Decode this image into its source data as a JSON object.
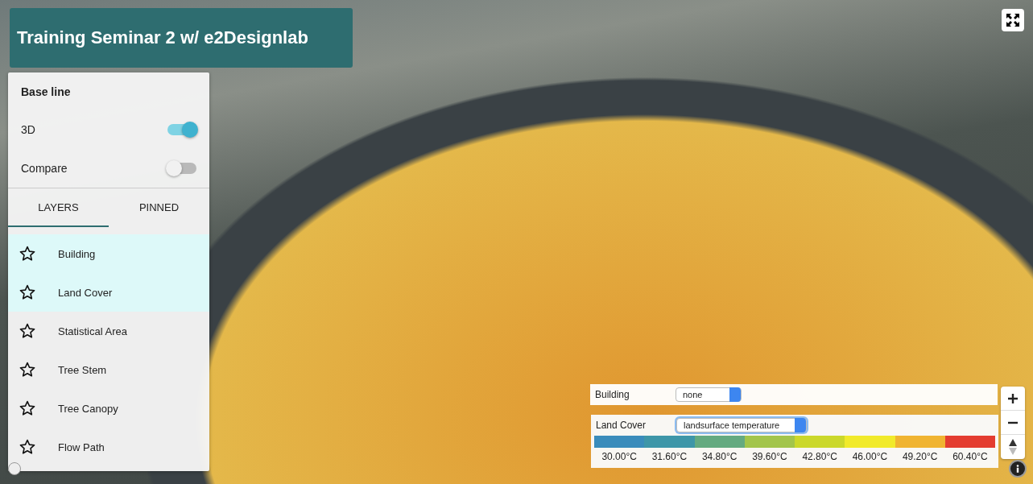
{
  "title": "Training Seminar 2 w/ e2Designlab",
  "panel": {
    "heading": "Base line",
    "toggles": [
      {
        "label": "3D",
        "on": true
      },
      {
        "label": "Compare",
        "on": false
      }
    ],
    "tabs": [
      {
        "label": "LAYERS",
        "selected": true
      },
      {
        "label": "PINNED",
        "selected": false
      }
    ],
    "layers": [
      {
        "label": "Building",
        "selected": true
      },
      {
        "label": "Land Cover",
        "selected": true
      },
      {
        "label": "Statistical Area",
        "selected": false
      },
      {
        "label": "Tree Stem",
        "selected": false
      },
      {
        "label": "Tree Canopy",
        "selected": false
      },
      {
        "label": "Flow Path",
        "selected": false
      }
    ]
  },
  "building_control": {
    "label": "Building",
    "value": "none"
  },
  "land_cover_legend": {
    "label": "Land Cover",
    "value": "landsurface temperature",
    "stops": [
      {
        "label": "30.00°C",
        "color": "#3a8cbb"
      },
      {
        "label": "31.60°C",
        "color": "#3e96a8"
      },
      {
        "label": "34.80°C",
        "color": "#65aa80"
      },
      {
        "label": "39.60°C",
        "color": "#a3c54b"
      },
      {
        "label": "42.80°C",
        "color": "#cbd82b"
      },
      {
        "label": "46.00°C",
        "color": "#f1ea2a"
      },
      {
        "label": "49.20°C",
        "color": "#f0b431"
      },
      {
        "label": "60.40°C",
        "color": "#e43d30"
      }
    ]
  }
}
